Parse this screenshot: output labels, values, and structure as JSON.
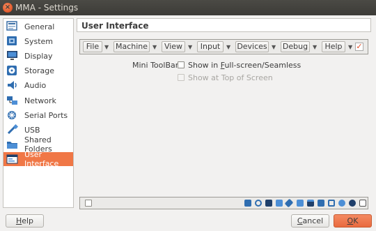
{
  "window": {
    "title": "MMA - Settings"
  },
  "sidebar": {
    "items": [
      {
        "label": "General",
        "icon": "general-icon"
      },
      {
        "label": "System",
        "icon": "system-icon"
      },
      {
        "label": "Display",
        "icon": "display-icon"
      },
      {
        "label": "Storage",
        "icon": "storage-icon"
      },
      {
        "label": "Audio",
        "icon": "audio-icon"
      },
      {
        "label": "Network",
        "icon": "network-icon"
      },
      {
        "label": "Serial Ports",
        "icon": "serial-ports-icon"
      },
      {
        "label": "USB",
        "icon": "usb-icon"
      },
      {
        "label": "Shared Folders",
        "icon": "shared-folders-icon"
      },
      {
        "label": "User Interface",
        "icon": "user-interface-icon",
        "selected": true
      }
    ]
  },
  "main": {
    "title": "User Interface",
    "menubar": {
      "items": [
        "File",
        "Machine",
        "View",
        "Input",
        "Devices",
        "Debug",
        "Help"
      ],
      "enabled_checked": true
    },
    "mini_toolbar": {
      "label": "Mini ToolBar:",
      "show_fullscreen_pre": "Show in ",
      "show_fullscreen_accel": "F",
      "show_fullscreen_post": "ull-screen/Seamless",
      "show_fullscreen_checked": false,
      "show_top": "Show at Top of Screen",
      "show_top_checked": false,
      "show_top_disabled": true
    }
  },
  "footer": {
    "help": {
      "accel": "H",
      "rest": "elp"
    },
    "cancel": {
      "accel": "C",
      "rest": "ancel"
    },
    "ok": {
      "accel": "O",
      "rest": "K"
    }
  },
  "colors": {
    "accent": "#f07746",
    "titlebar": "#3c3b37",
    "checkbox_mark": "#e14a22"
  }
}
